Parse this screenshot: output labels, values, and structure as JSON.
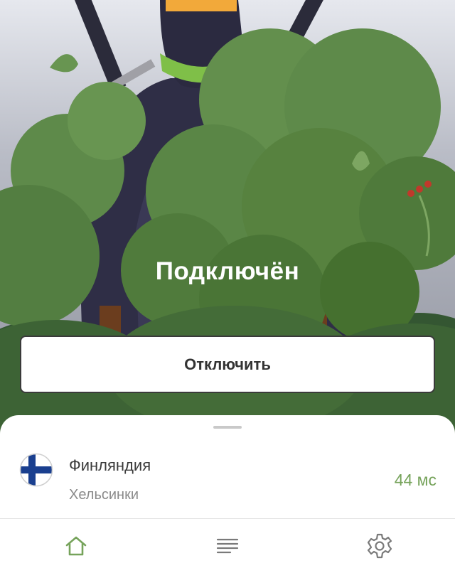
{
  "status": {
    "text": "Подключён"
  },
  "actions": {
    "disconnect_label": "Отключить"
  },
  "location": {
    "country": "Финляндия",
    "city": "Хельсинки",
    "ping": "44 мс",
    "flag_icon": "finland-flag-icon"
  },
  "colors": {
    "accent_green": "#76a35b",
    "bush_green": "#5e8a4a",
    "ninja_dark": "#2f2e46"
  },
  "nav": {
    "items": [
      {
        "icon": "home-icon",
        "active": true
      },
      {
        "icon": "list-icon",
        "active": false
      },
      {
        "icon": "gear-icon",
        "active": false
      }
    ]
  }
}
